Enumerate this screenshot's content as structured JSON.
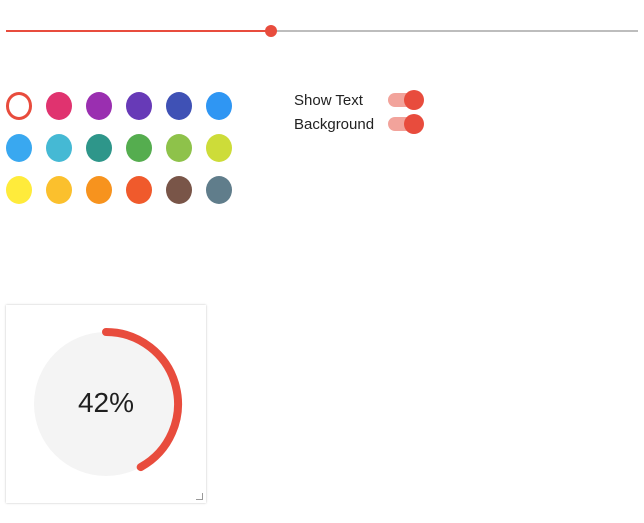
{
  "slider": {
    "value": 0.42
  },
  "accent_color": "#e84c3d",
  "palette": {
    "selected_index": 0,
    "rows": [
      [
        "#e84c3d",
        "#e0336f",
        "#9a2fb0",
        "#673ab7",
        "#3f51b5",
        "#2f96f3"
      ],
      [
        "#39a8f0",
        "#45b9d4",
        "#2e968a",
        "#55ad4f",
        "#8ec24a",
        "#cddc39"
      ],
      [
        "#ffeb3b",
        "#fbc02d",
        "#f7931e",
        "#f05a2c",
        "#795548",
        "#607d8b"
      ]
    ]
  },
  "toggles": {
    "show_text": {
      "label": "Show Text",
      "on": true
    },
    "background": {
      "label": "Background",
      "on": true
    }
  },
  "progress": {
    "value": 0.42,
    "label": "42%",
    "ring_color": "#e84c3d",
    "background_color": "#f4f4f4"
  }
}
